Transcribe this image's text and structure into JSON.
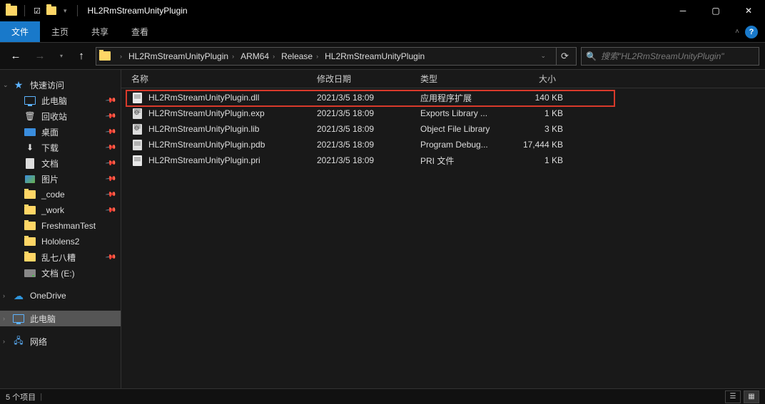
{
  "window": {
    "title": "HL2RmStreamUnityPlugin"
  },
  "ribbon": {
    "file": "文件",
    "home": "主页",
    "share": "共享",
    "view": "查看"
  },
  "breadcrumb": {
    "items": [
      "HL2RmStreamUnityPlugin",
      "ARM64",
      "Release",
      "HL2RmStreamUnityPlugin"
    ]
  },
  "search": {
    "placeholder": "搜索\"HL2RmStreamUnityPlugin\""
  },
  "sidebar": {
    "quickAccess": "快速访问",
    "items": [
      {
        "label": "此电脑",
        "icon": "pc",
        "pinned": true
      },
      {
        "label": "回收站",
        "icon": "recycle",
        "pinned": true
      },
      {
        "label": "桌面",
        "icon": "desktop",
        "pinned": true
      },
      {
        "label": "下载",
        "icon": "download",
        "pinned": true
      },
      {
        "label": "文档",
        "icon": "doc",
        "pinned": true
      },
      {
        "label": "图片",
        "icon": "img",
        "pinned": true
      },
      {
        "label": "_code",
        "icon": "folder",
        "pinned": true
      },
      {
        "label": "_work",
        "icon": "folder",
        "pinned": true
      },
      {
        "label": "FreshmanTest",
        "icon": "folder",
        "pinned": false
      },
      {
        "label": "Hololens2",
        "icon": "folder",
        "pinned": false
      },
      {
        "label": "乱七八糟",
        "icon": "folder",
        "pinned": true
      },
      {
        "label": "文档 (E:)",
        "icon": "drive",
        "pinned": false
      }
    ],
    "oneDrive": "OneDrive",
    "thisPC": "此电脑",
    "network": "网络"
  },
  "columns": {
    "name": "名称",
    "date": "修改日期",
    "type": "类型",
    "size": "大小"
  },
  "files": [
    {
      "name": "HL2RmStreamUnityPlugin.dll",
      "date": "2021/3/5 18:09",
      "type": "应用程序扩展",
      "size": "140 KB",
      "icon": "dll"
    },
    {
      "name": "HL2RmStreamUnityPlugin.exp",
      "date": "2021/3/5 18:09",
      "type": "Exports Library ...",
      "size": "1 KB",
      "icon": "exp"
    },
    {
      "name": "HL2RmStreamUnityPlugin.lib",
      "date": "2021/3/5 18:09",
      "type": "Object File Library",
      "size": "3 KB",
      "icon": "exp"
    },
    {
      "name": "HL2RmStreamUnityPlugin.pdb",
      "date": "2021/3/5 18:09",
      "type": "Program Debug...",
      "size": "17,444 KB",
      "icon": "pdb"
    },
    {
      "name": "HL2RmStreamUnityPlugin.pri",
      "date": "2021/3/5 18:09",
      "type": "PRI 文件",
      "size": "1 KB",
      "icon": "dll"
    }
  ],
  "status": {
    "itemCount": "5 个项目"
  }
}
